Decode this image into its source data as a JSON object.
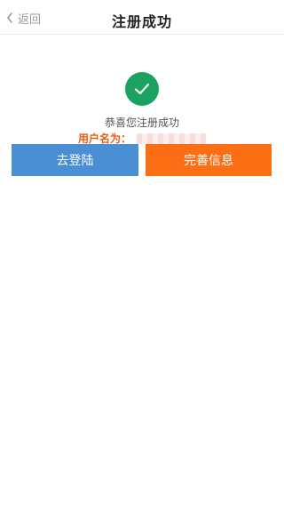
{
  "header": {
    "back_label": "返回",
    "title": "注册成功"
  },
  "success": {
    "message": "恭喜您注册成功",
    "username_label": "用户名为："
  },
  "actions": {
    "login_label": "去登陆",
    "complete_label": "完善信息"
  },
  "colors": {
    "success_green": "#1aa260",
    "login_blue": "#4a8fd3",
    "complete_orange": "#fc6e14",
    "label_orange": "#f05a0d"
  },
  "icons": {
    "back": "chevron-left-icon",
    "success": "checkmark-icon"
  }
}
